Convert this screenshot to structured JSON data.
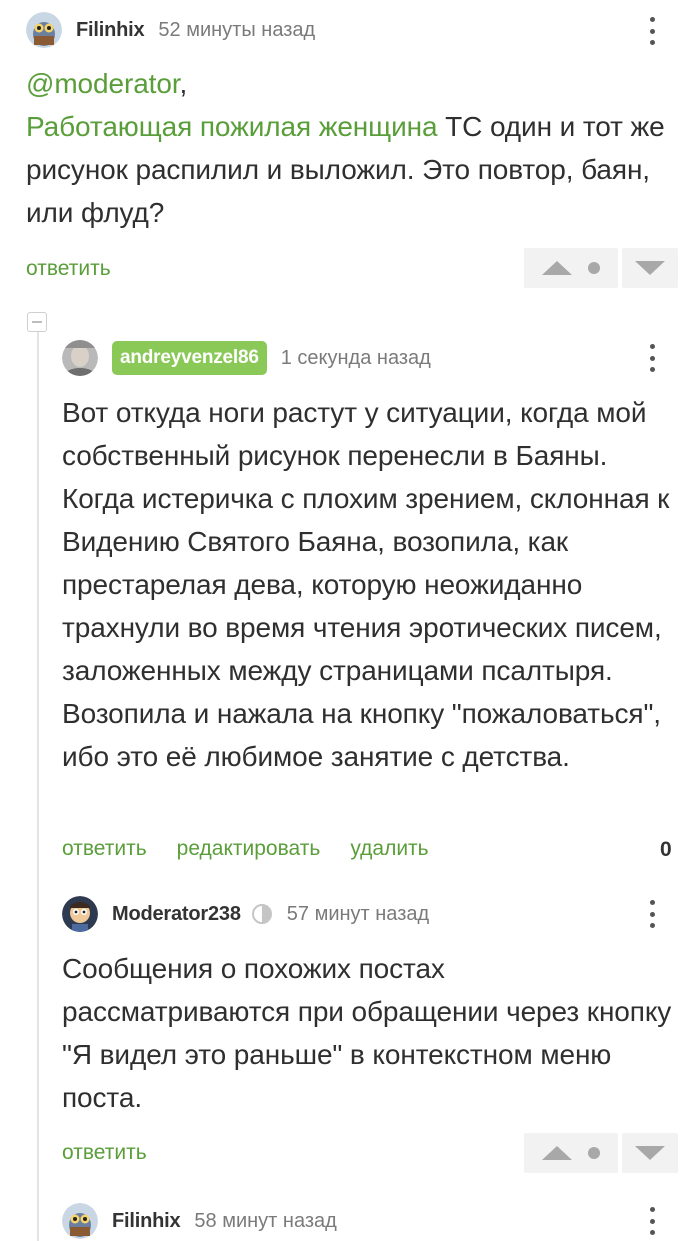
{
  "comments": [
    {
      "username": "Filinhix",
      "time": "52 минуты назад",
      "mention": "@moderator",
      "mention_suffix": ",",
      "link_text": "Работающая пожилая женщина",
      "text_after_link": " ТС один и тот же рисунок распилил и выложил. Это повтор, баян, или флуд?",
      "reply_label": "ответить"
    },
    {
      "username": "andreyvenzel86",
      "time": "1 секунда назад",
      "text": "Вот откуда ноги растут у ситуации, когда мой собственный рисунок перенесли в Баяны. Когда истеричка с плохим зрением, склонная к Видению Святого Баяна, возопила, как престарелая дева, которую неожиданно трахнули во время чтения эротических писем, заложенных между страницами псалтыря. Возопила и нажала на кнопку \"пожаловаться\", ибо это её любимое занятие с детства.",
      "reply_label": "ответить",
      "edit_label": "редактировать",
      "delete_label": "удалить",
      "rating": "0"
    },
    {
      "username": "Moderator238",
      "time": "57 минут назад",
      "text": "Сообщения о похожих постах рассматриваются при обращении через кнопку \"Я видел это раньше\" в контекстном меню поста.",
      "reply_label": "ответить"
    },
    {
      "username": "Filinhix",
      "time": "58 минут назад"
    }
  ],
  "colors": {
    "accent_green": "#5a9e3a",
    "badge_green": "#8ac858",
    "vote_bg": "#f2f2f2"
  },
  "icons": [
    "more-vertical-icon",
    "vote-up-icon",
    "vote-down-icon",
    "collapse-icon",
    "moderator-shield-icon"
  ]
}
